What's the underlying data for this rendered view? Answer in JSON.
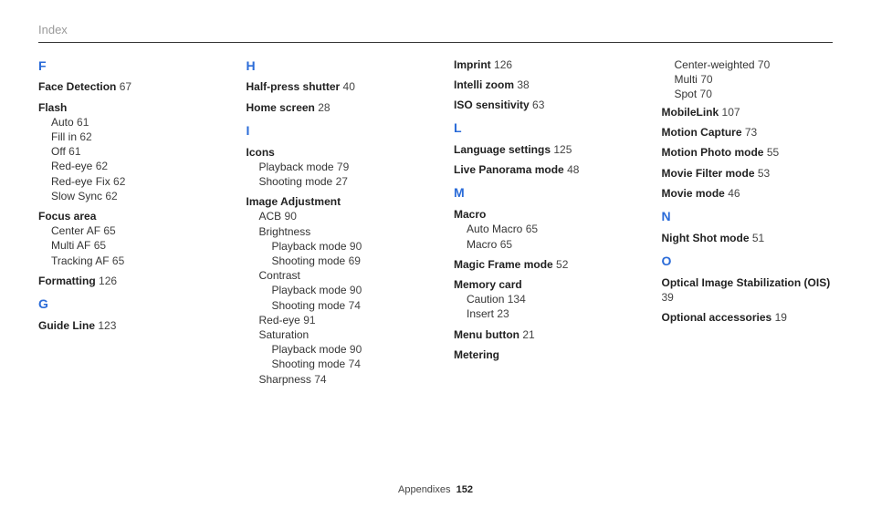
{
  "header": {
    "title": "Index"
  },
  "footer": {
    "section": "Appendixes",
    "page": "152"
  },
  "letters": {
    "F": "F",
    "G": "G",
    "H": "H",
    "I": "I",
    "L": "L",
    "M": "M",
    "N": "N",
    "O": "O"
  },
  "idx": {
    "face_detection": {
      "label": "Face Detection",
      "page": "67"
    },
    "flash": {
      "label": "Flash",
      "auto": {
        "label": "Auto",
        "page": "61"
      },
      "fill_in": {
        "label": "Fill in",
        "page": "62"
      },
      "off": {
        "label": "Off",
        "page": "61"
      },
      "red_eye": {
        "label": "Red-eye",
        "page": "62"
      },
      "red_eye_fix": {
        "label": "Red-eye Fix",
        "page": "62"
      },
      "slow_sync": {
        "label": "Slow Sync",
        "page": "62"
      }
    },
    "focus_area": {
      "label": "Focus area",
      "center_af": {
        "label": "Center AF",
        "page": "65"
      },
      "multi_af": {
        "label": "Multi AF",
        "page": "65"
      },
      "tracking_af": {
        "label": "Tracking AF",
        "page": "65"
      }
    },
    "formatting": {
      "label": "Formatting",
      "page": "126"
    },
    "guide_line": {
      "label": "Guide Line",
      "page": "123"
    },
    "half_press": {
      "label": "Half-press shutter",
      "page": "40"
    },
    "home_screen": {
      "label": "Home screen",
      "page": "28"
    },
    "icons": {
      "label": "Icons",
      "playback": {
        "label": "Playback mode",
        "page": "79"
      },
      "shooting": {
        "label": "Shooting mode",
        "page": "27"
      }
    },
    "image_adj": {
      "label": "Image Adjustment",
      "acb": {
        "label": "ACB",
        "page": "90"
      },
      "brightness": {
        "label": "Brightness",
        "playback": {
          "label": "Playback mode",
          "page": "90"
        },
        "shooting": {
          "label": "Shooting mode",
          "page": "69"
        }
      },
      "contrast": {
        "label": "Contrast",
        "playback": {
          "label": "Playback mode",
          "page": "90"
        },
        "shooting": {
          "label": "Shooting mode",
          "page": "74"
        }
      },
      "red_eye": {
        "label": "Red-eye",
        "page": "91"
      },
      "saturation": {
        "label": "Saturation",
        "playback": {
          "label": "Playback mode",
          "page": "90"
        },
        "shooting": {
          "label": "Shooting mode",
          "page": "74"
        }
      },
      "sharpness": {
        "label": "Sharpness",
        "page": "74"
      }
    },
    "imprint": {
      "label": "Imprint",
      "page": "126"
    },
    "intelli_zoom": {
      "label": "Intelli zoom",
      "page": "38"
    },
    "iso": {
      "label": "ISO sensitivity",
      "page": "63"
    },
    "language": {
      "label": "Language settings",
      "page": "125"
    },
    "live_pano": {
      "label": "Live Panorama mode",
      "page": "48"
    },
    "macro": {
      "label": "Macro",
      "auto_macro": {
        "label": "Auto Macro",
        "page": "65"
      },
      "macro": {
        "label": "Macro",
        "page": "65"
      }
    },
    "magic_frame": {
      "label": "Magic Frame mode",
      "page": "52"
    },
    "memory_card": {
      "label": "Memory card",
      "caution": {
        "label": "Caution",
        "page": "134"
      },
      "insert": {
        "label": "Insert",
        "page": "23"
      }
    },
    "menu_button": {
      "label": "Menu button",
      "page": "21"
    },
    "metering": {
      "label": "Metering",
      "center_weighted": {
        "label": "Center-weighted",
        "page": "70"
      },
      "multi": {
        "label": "Multi",
        "page": "70"
      },
      "spot": {
        "label": "Spot",
        "page": "70"
      }
    },
    "mobilelink": {
      "label": "MobileLink",
      "page": "107"
    },
    "motion_cap": {
      "label": "Motion Capture",
      "page": "73"
    },
    "motion_photo": {
      "label": "Motion Photo mode",
      "page": "55"
    },
    "movie_filter": {
      "label": "Movie Filter mode",
      "page": "53"
    },
    "movie_mode": {
      "label": "Movie mode",
      "page": "46"
    },
    "night_shot": {
      "label": "Night Shot mode",
      "page": "51"
    },
    "ois": {
      "label": "Optical Image Stabilization (OIS)",
      "page": "39"
    },
    "opt_acc": {
      "label": "Optional accessories",
      "page": "19"
    }
  }
}
